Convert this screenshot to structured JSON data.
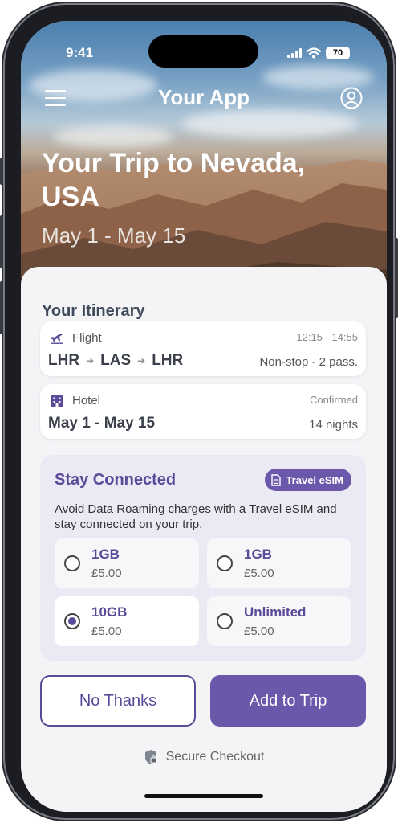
{
  "status": {
    "time": "9:41",
    "battery": "70"
  },
  "appbar": {
    "title": "Your App"
  },
  "hero": {
    "title": "Your Trip to Nevada, USA",
    "dates": "May 1 - May 15"
  },
  "itinerary": {
    "title": "Your Itinerary",
    "flight": {
      "label": "Flight",
      "times": "12:15 - 14:55",
      "from": "LHR",
      "via": "LAS",
      "to": "LHR",
      "details": "Non-stop - 2 pass."
    },
    "hotel": {
      "label": "Hotel",
      "status": "Confirmed",
      "dates": "May 1 - May 15",
      "nights": "14 nights"
    }
  },
  "esim": {
    "title": "Stay Connected",
    "badge": "Travel eSIM",
    "description": "Avoid Data Roaming charges with a Travel eSIM and stay connected on your trip.",
    "plans": [
      {
        "name": "1GB",
        "price": "£5.00",
        "selected": false
      },
      {
        "name": "1GB",
        "price": "£5.00",
        "selected": false
      },
      {
        "name": "10GB",
        "price": "£5.00",
        "selected": true
      },
      {
        "name": "Unlimited",
        "price": "£5.00",
        "selected": false
      }
    ]
  },
  "actions": {
    "decline": "No Thanks",
    "accept": "Add to Trip"
  },
  "footer": {
    "secure": "Secure Checkout"
  },
  "colors": {
    "accent": "#6b58ab",
    "accent_text": "#5b4a98"
  }
}
